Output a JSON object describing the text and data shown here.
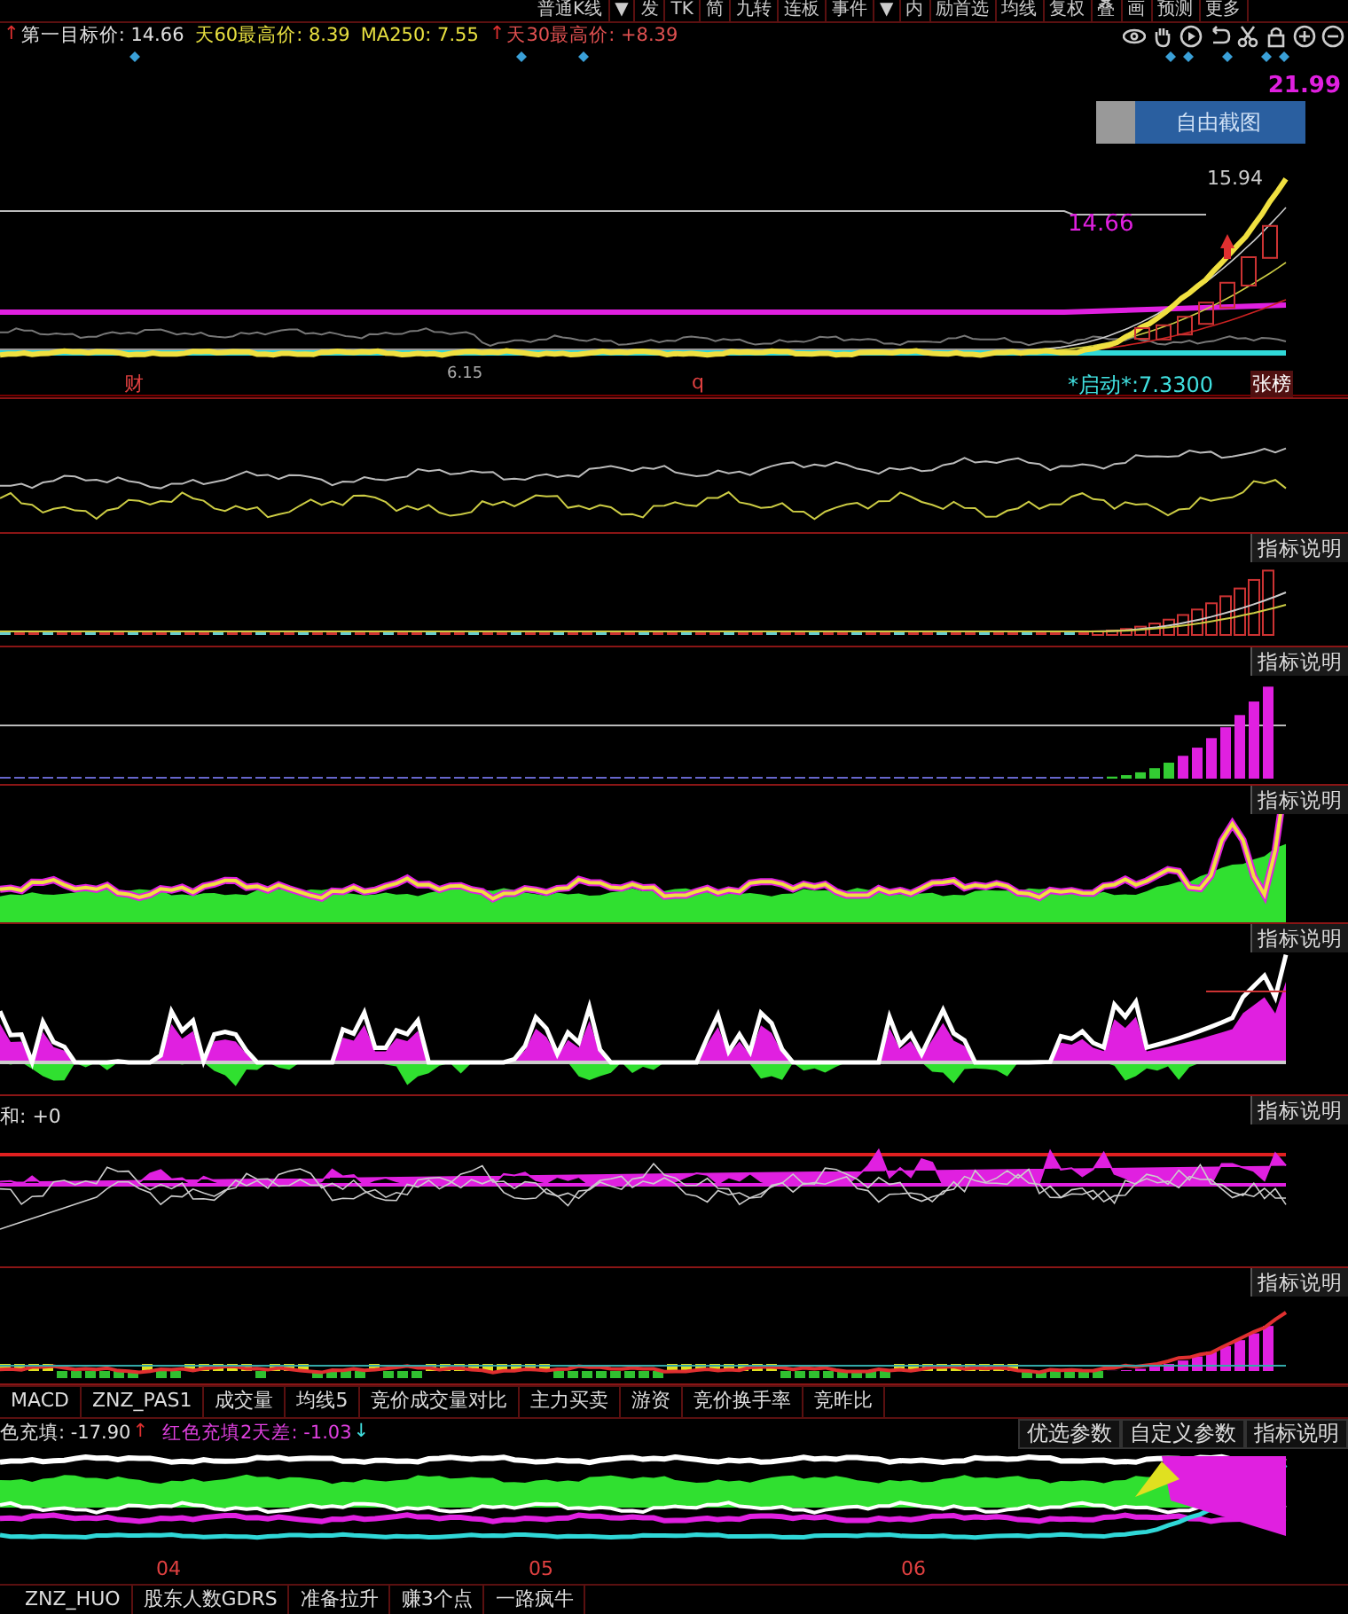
{
  "toolbar": {
    "items": [
      "普通K线",
      "▼",
      "发",
      "TK",
      "简",
      "九转",
      "连板",
      "事件",
      "▼",
      "内",
      "励首选",
      "均线",
      "复权",
      "叠",
      "画",
      "预测",
      "更多"
    ]
  },
  "header": {
    "indicators": [
      {
        "arrow": "↑",
        "text": "第一目标价: 14.66",
        "color": "#e0e0e0"
      },
      {
        "text": "天60最高价: 8.39",
        "color": "#e8e040"
      },
      {
        "text": "MA250: 7.55",
        "color": "#e8e040"
      },
      {
        "arrow": "↑",
        "text": "天30最高价: +8.39",
        "color": "#e05050"
      }
    ]
  },
  "main_chart": {
    "high_label": "21.99",
    "screenshot_button": "自由截图",
    "peak_label": "15.94",
    "target_label": "14.66",
    "low_label": "6.15",
    "marks": [
      "财",
      "q"
    ],
    "start_label": "*启动*:7.3300",
    "limit_badge": "张榜"
  },
  "panels": [
    {
      "kind": "lines"
    },
    {
      "kind": "vol",
      "button": "指标说明"
    },
    {
      "kind": "bars",
      "button": "指标说明"
    },
    {
      "kind": "wave",
      "button": "指标说明"
    },
    {
      "kind": "spikes",
      "button": "指标说明"
    },
    {
      "kind": "bands",
      "button": "指标说明",
      "label": "和: +0"
    },
    {
      "kind": "macd",
      "button": "指标说明"
    }
  ],
  "indicator_tabs": [
    {
      "label": "MACD",
      "selected": false
    },
    {
      "label": "ZNZ_PAS1",
      "selected": false
    },
    {
      "label": "成交量",
      "selected": false
    },
    {
      "label": "均线5",
      "selected": false
    },
    {
      "label": "竞价成交量对比",
      "selected": false
    },
    {
      "label": "主力买卖",
      "selected": false
    },
    {
      "label": "游资",
      "selected": false
    },
    {
      "label": "竞价换手率",
      "selected": false
    },
    {
      "label": "竞昨比",
      "selected": false
    }
  ],
  "bottom_indicator": {
    "readings": [
      {
        "text": "色充填: -17.90",
        "arrow": "↑",
        "color": "#e0e0e0"
      },
      {
        "text": "红色充填2天差: -1.03",
        "arrow": "↓",
        "color": "#e040e0"
      }
    ],
    "buttons": [
      "优选参数",
      "自定义参数",
      "指标说明"
    ],
    "months": [
      "04",
      "05",
      "06"
    ]
  },
  "bottom_tabs": [
    {
      "label": "ZNZ_HUO",
      "selected": false
    },
    {
      "label": "股东人数GDRS",
      "selected": false
    },
    {
      "label": "准备拉升",
      "selected": false
    },
    {
      "label": "赚3个点",
      "selected": false
    },
    {
      "label": "一路疯牛",
      "selected": false
    }
  ]
}
